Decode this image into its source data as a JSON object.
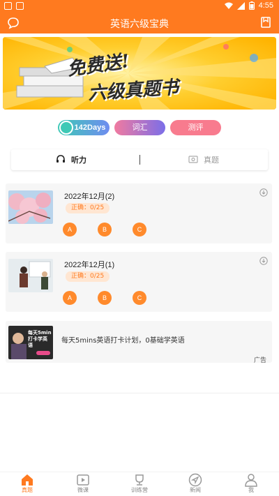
{
  "status": {
    "time": "4:55"
  },
  "header": {
    "title": "英语六级宝典"
  },
  "banner": {
    "line1": "免费送!",
    "line2": "六级真题书"
  },
  "pills": {
    "days": "142Days",
    "vocab": "词汇",
    "eval": "测评"
  },
  "tabs": {
    "listen": "听力",
    "real": "真题"
  },
  "cards": [
    {
      "title": "2022年12月(2)",
      "score": "正确：0/25",
      "options": [
        "A",
        "B",
        "C"
      ]
    },
    {
      "title": "2022年12月(1)",
      "score": "正确：0/25",
      "options": [
        "A",
        "B",
        "C"
      ]
    }
  ],
  "ad": {
    "text": "每天5mins英语打卡计划，0基础学英语",
    "label": "广告",
    "thumb_text": "每天5min 打卡学英语"
  },
  "nav": [
    "真题",
    "微课",
    "训练营",
    "新闻",
    "我"
  ],
  "colors": {
    "accent": "#ff7a1f",
    "banner_bg": "#ffc21a"
  }
}
